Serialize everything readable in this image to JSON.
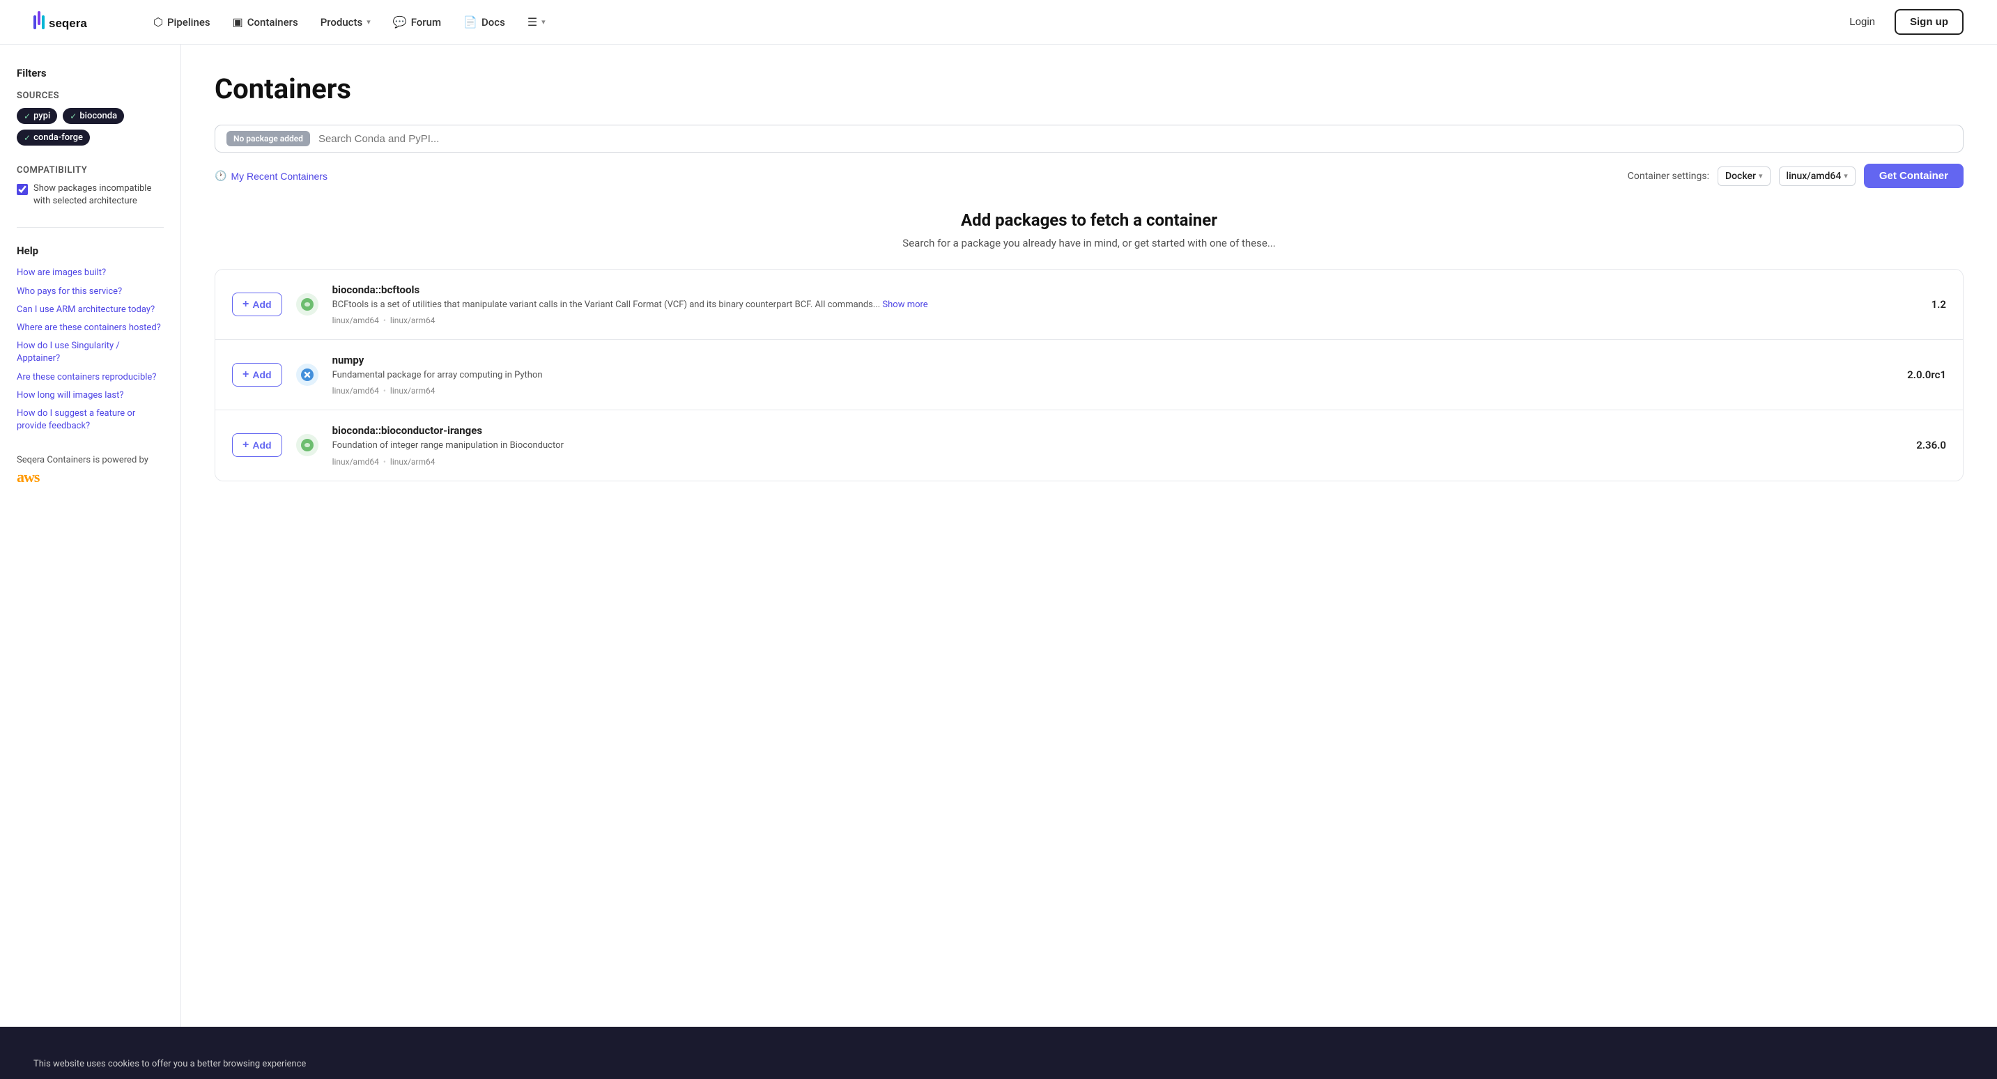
{
  "navbar": {
    "logo_text": "seqera",
    "links": [
      {
        "id": "pipelines",
        "label": "Pipelines",
        "icon": "🔷",
        "has_chevron": false
      },
      {
        "id": "containers",
        "label": "Containers",
        "icon": "📦",
        "has_chevron": false
      },
      {
        "id": "products",
        "label": "Products",
        "icon": "",
        "has_chevron": true
      },
      {
        "id": "forum",
        "label": "Forum",
        "icon": "💬",
        "has_chevron": false
      },
      {
        "id": "docs",
        "label": "Docs",
        "icon": "📄",
        "has_chevron": false
      },
      {
        "id": "more",
        "label": "",
        "icon": "☰",
        "has_chevron": true
      }
    ],
    "login_label": "Login",
    "signup_label": "Sign up"
  },
  "sidebar": {
    "filters_title": "Filters",
    "sources_label": "Sources",
    "tags": [
      {
        "id": "pypi",
        "label": "pypi",
        "checked": true
      },
      {
        "id": "bioconda",
        "label": "bioconda",
        "checked": true
      },
      {
        "id": "conda-forge",
        "label": "conda-forge",
        "checked": true
      }
    ],
    "compatibility_label": "Compatibility",
    "compatibility_checkbox_label": "Show packages incompatible with selected architecture",
    "compatibility_checked": true,
    "help_title": "Help",
    "help_links": [
      "How are images built?",
      "Who pays for this service?",
      "Can I use ARM architecture today?",
      "Where are these containers hosted?",
      "How do I use Singularity / Apptainer?",
      "Are these containers reproducible?",
      "How long will images last?",
      "How do I suggest a feature or provide feedback?"
    ],
    "powered_by_text": "Seqera Containers is powered by",
    "aws_label": "aws"
  },
  "main": {
    "page_title": "Containers",
    "search": {
      "no_package_badge": "No package added",
      "placeholder": "Search Conda and PyPI..."
    },
    "recent_containers_label": "My Recent Containers",
    "container_settings_label": "Container settings:",
    "docker_label": "Docker",
    "arch_label": "linux/amd64",
    "get_container_label": "Get Container",
    "add_packages_heading": "Add packages to fetch a container",
    "add_packages_subtext": "Search for a package you already have in mind, or get started with one of these...",
    "packages": [
      {
        "id": "bcftools",
        "icon_type": "bioconda",
        "icon": "🔵",
        "name": "bioconda::bcftools",
        "description": "BCFtools is a set of utilities that manipulate variant calls in the Variant Call Format (VCF) and its binary counterpart BCF. All commands...",
        "show_more": "Show more",
        "platforms": [
          "linux/amd64",
          "linux/arm64"
        ],
        "version": "1.2",
        "add_label": "Add"
      },
      {
        "id": "numpy",
        "icon_type": "pypi",
        "icon": "🐍",
        "name": "numpy",
        "description": "Fundamental package for array computing in Python",
        "show_more": "",
        "platforms": [
          "linux/amd64",
          "linux/arm64"
        ],
        "version": "2.0.0rc1",
        "add_label": "Add"
      },
      {
        "id": "bioconductor-iranges",
        "icon_type": "bioconda",
        "icon": "🔵",
        "name": "bioconda::bioconductor-iranges",
        "description": "Foundation of integer range manipulation in Bioconductor",
        "show_more": "",
        "platforms": [
          "linux/amd64",
          "linux/arm64"
        ],
        "version": "2.36.0",
        "add_label": "Add"
      }
    ]
  },
  "footer": {
    "cookie_text": "This website uses cookies to offer you a better browsing experience"
  }
}
